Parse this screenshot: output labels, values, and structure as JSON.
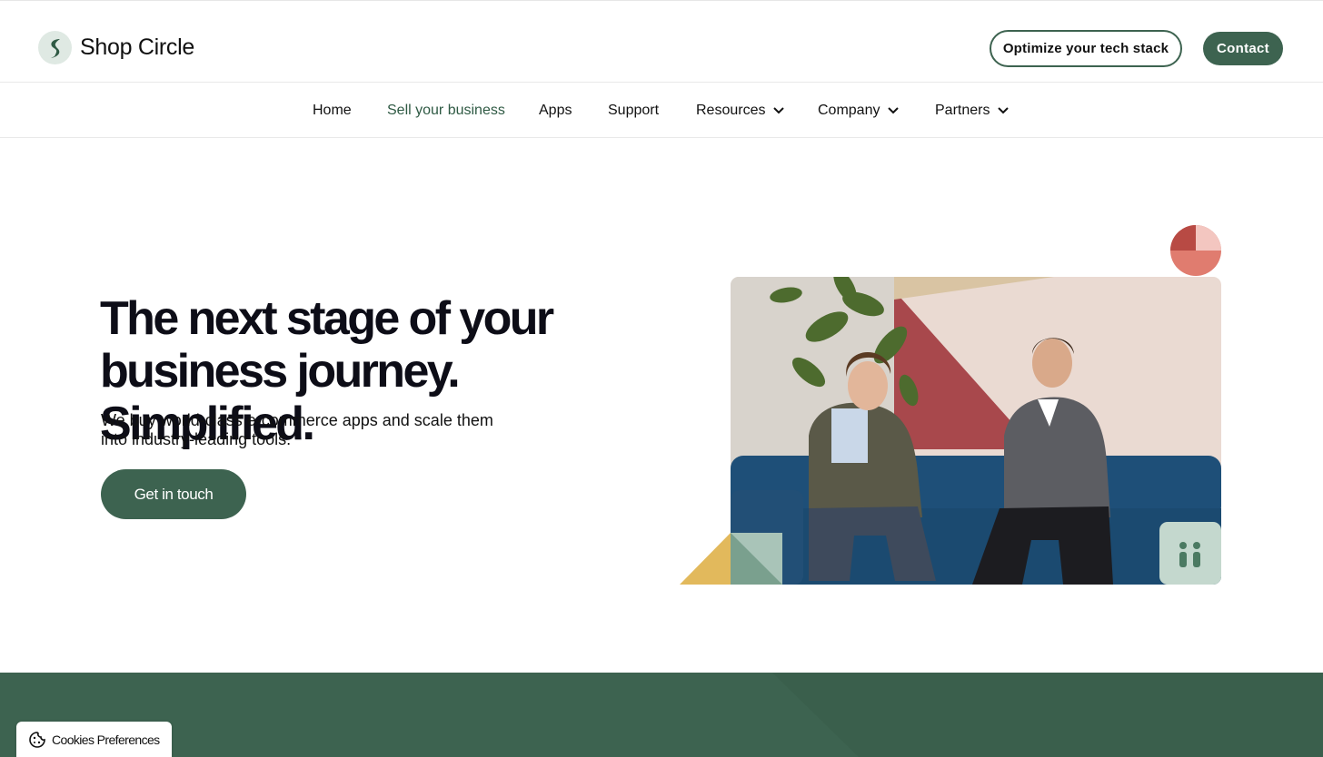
{
  "header": {
    "brand": "Shop Circle",
    "optimize_label": "Optimize your tech stack",
    "contact_label": "Contact"
  },
  "nav": {
    "items": [
      {
        "label": "Home",
        "active": false,
        "dropdown": false
      },
      {
        "label": "Sell your business",
        "active": true,
        "dropdown": false
      },
      {
        "label": "Apps",
        "active": false,
        "dropdown": false
      },
      {
        "label": "Support",
        "active": false,
        "dropdown": false
      },
      {
        "label": "Resources",
        "active": false,
        "dropdown": true
      },
      {
        "label": "Company",
        "active": false,
        "dropdown": true
      },
      {
        "label": "Partners",
        "active": false,
        "dropdown": true
      }
    ]
  },
  "hero": {
    "title_line1": "The next stage of your",
    "title_line2": "business journey. Simplified.",
    "subtitle_line1": "We buy world-class e-commerce apps and scale them",
    "subtitle_line2": "into industry-leading tools.",
    "cta_label": "Get in touch",
    "photo_icon": "photo-of-two-founders-on-sofa"
  },
  "cookies": {
    "label": "Cookies Preferences",
    "icon": "cookie-icon"
  },
  "colors": {
    "brand_green": "#3d6350",
    "active_nav": "#2f5a44",
    "accent_red": "#c9504c",
    "accent_yellow": "#e2b95c"
  }
}
